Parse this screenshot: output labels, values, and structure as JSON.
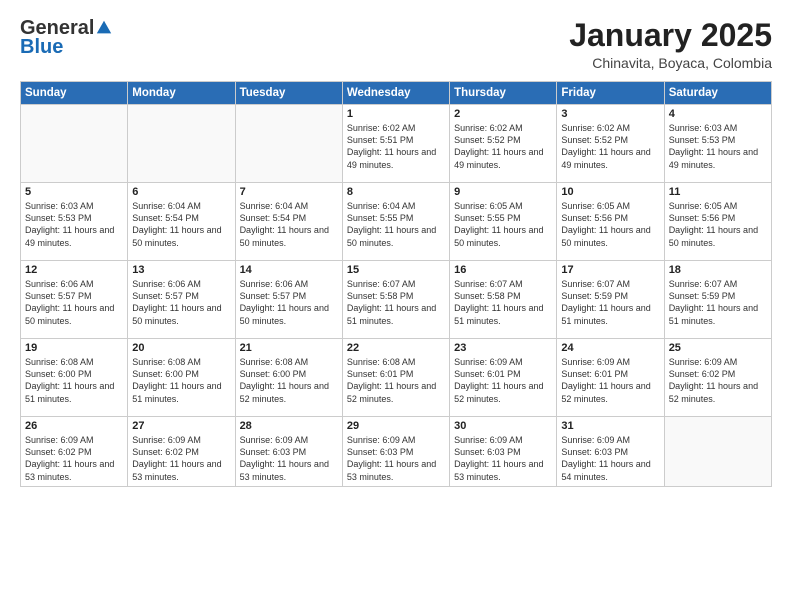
{
  "header": {
    "logo_general": "General",
    "logo_blue": "Blue",
    "month_title": "January 2025",
    "location": "Chinavita, Boyaca, Colombia"
  },
  "days_of_week": [
    "Sunday",
    "Monday",
    "Tuesday",
    "Wednesday",
    "Thursday",
    "Friday",
    "Saturday"
  ],
  "weeks": [
    [
      {
        "day": "",
        "info": ""
      },
      {
        "day": "",
        "info": ""
      },
      {
        "day": "",
        "info": ""
      },
      {
        "day": "1",
        "info": "Sunrise: 6:02 AM\nSunset: 5:51 PM\nDaylight: 11 hours and 49 minutes."
      },
      {
        "day": "2",
        "info": "Sunrise: 6:02 AM\nSunset: 5:52 PM\nDaylight: 11 hours and 49 minutes."
      },
      {
        "day": "3",
        "info": "Sunrise: 6:02 AM\nSunset: 5:52 PM\nDaylight: 11 hours and 49 minutes."
      },
      {
        "day": "4",
        "info": "Sunrise: 6:03 AM\nSunset: 5:53 PM\nDaylight: 11 hours and 49 minutes."
      }
    ],
    [
      {
        "day": "5",
        "info": "Sunrise: 6:03 AM\nSunset: 5:53 PM\nDaylight: 11 hours and 49 minutes."
      },
      {
        "day": "6",
        "info": "Sunrise: 6:04 AM\nSunset: 5:54 PM\nDaylight: 11 hours and 50 minutes."
      },
      {
        "day": "7",
        "info": "Sunrise: 6:04 AM\nSunset: 5:54 PM\nDaylight: 11 hours and 50 minutes."
      },
      {
        "day": "8",
        "info": "Sunrise: 6:04 AM\nSunset: 5:55 PM\nDaylight: 11 hours and 50 minutes."
      },
      {
        "day": "9",
        "info": "Sunrise: 6:05 AM\nSunset: 5:55 PM\nDaylight: 11 hours and 50 minutes."
      },
      {
        "day": "10",
        "info": "Sunrise: 6:05 AM\nSunset: 5:56 PM\nDaylight: 11 hours and 50 minutes."
      },
      {
        "day": "11",
        "info": "Sunrise: 6:05 AM\nSunset: 5:56 PM\nDaylight: 11 hours and 50 minutes."
      }
    ],
    [
      {
        "day": "12",
        "info": "Sunrise: 6:06 AM\nSunset: 5:57 PM\nDaylight: 11 hours and 50 minutes."
      },
      {
        "day": "13",
        "info": "Sunrise: 6:06 AM\nSunset: 5:57 PM\nDaylight: 11 hours and 50 minutes."
      },
      {
        "day": "14",
        "info": "Sunrise: 6:06 AM\nSunset: 5:57 PM\nDaylight: 11 hours and 50 minutes."
      },
      {
        "day": "15",
        "info": "Sunrise: 6:07 AM\nSunset: 5:58 PM\nDaylight: 11 hours and 51 minutes."
      },
      {
        "day": "16",
        "info": "Sunrise: 6:07 AM\nSunset: 5:58 PM\nDaylight: 11 hours and 51 minutes."
      },
      {
        "day": "17",
        "info": "Sunrise: 6:07 AM\nSunset: 5:59 PM\nDaylight: 11 hours and 51 minutes."
      },
      {
        "day": "18",
        "info": "Sunrise: 6:07 AM\nSunset: 5:59 PM\nDaylight: 11 hours and 51 minutes."
      }
    ],
    [
      {
        "day": "19",
        "info": "Sunrise: 6:08 AM\nSunset: 6:00 PM\nDaylight: 11 hours and 51 minutes."
      },
      {
        "day": "20",
        "info": "Sunrise: 6:08 AM\nSunset: 6:00 PM\nDaylight: 11 hours and 51 minutes."
      },
      {
        "day": "21",
        "info": "Sunrise: 6:08 AM\nSunset: 6:00 PM\nDaylight: 11 hours and 52 minutes."
      },
      {
        "day": "22",
        "info": "Sunrise: 6:08 AM\nSunset: 6:01 PM\nDaylight: 11 hours and 52 minutes."
      },
      {
        "day": "23",
        "info": "Sunrise: 6:09 AM\nSunset: 6:01 PM\nDaylight: 11 hours and 52 minutes."
      },
      {
        "day": "24",
        "info": "Sunrise: 6:09 AM\nSunset: 6:01 PM\nDaylight: 11 hours and 52 minutes."
      },
      {
        "day": "25",
        "info": "Sunrise: 6:09 AM\nSunset: 6:02 PM\nDaylight: 11 hours and 52 minutes."
      }
    ],
    [
      {
        "day": "26",
        "info": "Sunrise: 6:09 AM\nSunset: 6:02 PM\nDaylight: 11 hours and 53 minutes."
      },
      {
        "day": "27",
        "info": "Sunrise: 6:09 AM\nSunset: 6:02 PM\nDaylight: 11 hours and 53 minutes."
      },
      {
        "day": "28",
        "info": "Sunrise: 6:09 AM\nSunset: 6:03 PM\nDaylight: 11 hours and 53 minutes."
      },
      {
        "day": "29",
        "info": "Sunrise: 6:09 AM\nSunset: 6:03 PM\nDaylight: 11 hours and 53 minutes."
      },
      {
        "day": "30",
        "info": "Sunrise: 6:09 AM\nSunset: 6:03 PM\nDaylight: 11 hours and 53 minutes."
      },
      {
        "day": "31",
        "info": "Sunrise: 6:09 AM\nSunset: 6:03 PM\nDaylight: 11 hours and 54 minutes."
      },
      {
        "day": "",
        "info": ""
      }
    ]
  ]
}
